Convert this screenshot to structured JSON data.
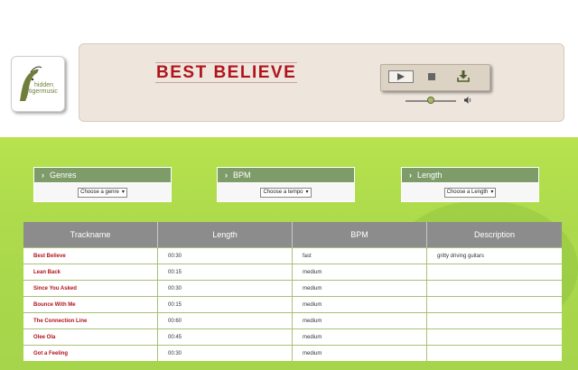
{
  "brand": {
    "logo_text_line1": "hidden",
    "logo_text_line2": "tigermusic",
    "logo_icon": "tiger-sketch-logo"
  },
  "player": {
    "track_title": "BEST BELIEVE",
    "play_icon": "play-icon",
    "stop_icon": "stop-icon",
    "download_icon": "download-icon",
    "volume_icon": "speaker-icon",
    "volume_level": 0.5
  },
  "filters": [
    {
      "label": "Genres",
      "select_value": "Choose a genre"
    },
    {
      "label": "BPM",
      "select_value": "Choose a tempo"
    },
    {
      "label": "Length",
      "select_value": "Choose a Length"
    }
  ],
  "table": {
    "columns": [
      "Trackname",
      "Length",
      "BPM",
      "Description"
    ],
    "rows": [
      {
        "name": "Best Believe",
        "length": "00:30",
        "bpm": "fast",
        "description": "gritty driving guitars"
      },
      {
        "name": "Lean Back",
        "length": "00:15",
        "bpm": "medium",
        "description": ""
      },
      {
        "name": "Since You Asked",
        "length": "00:30",
        "bpm": "medium",
        "description": ""
      },
      {
        "name": "Bounce With Me",
        "length": "00:15",
        "bpm": "medium",
        "description": ""
      },
      {
        "name": "The Connection Line",
        "length": "00:60",
        "bpm": "medium",
        "description": ""
      },
      {
        "name": "Olee Ola",
        "length": "00:45",
        "bpm": "medium",
        "description": ""
      },
      {
        "name": "Got a Feeling",
        "length": "00:30",
        "bpm": "medium",
        "description": ""
      }
    ]
  },
  "colors": {
    "title_red": "#b0141d",
    "panel_beige": "#eee6dc",
    "green_bg": "#addb4c",
    "filter_header": "#7e9c6a",
    "table_header": "#8c8c8c"
  }
}
